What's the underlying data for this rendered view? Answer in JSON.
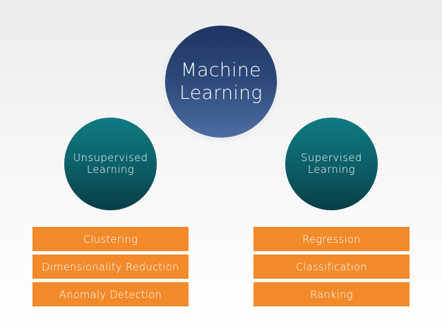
{
  "root": {
    "label": "Machine Learning"
  },
  "branches": [
    {
      "label": "Unsupervised Learning",
      "items": [
        "Clustering",
        "Dimensionality Reduction",
        "Anomaly Detection"
      ]
    },
    {
      "label": "Supervised Learning",
      "items": [
        "Regression",
        "Classification",
        "Ranking"
      ]
    }
  ],
  "colors": {
    "root_circle": "#2e4a7a",
    "branch_circle": "#0c5d66",
    "item_box": "#f28a2a",
    "text": "#ffffff"
  }
}
